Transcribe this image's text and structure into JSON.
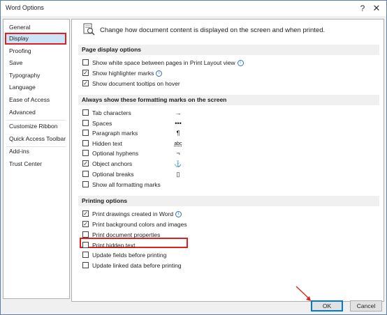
{
  "window": {
    "title": "Word Options",
    "help_icon": "?",
    "close_icon": "✕"
  },
  "sidebar": {
    "items": [
      {
        "label": "General"
      },
      {
        "label": "Display",
        "selected": true
      },
      {
        "label": "Proofing"
      },
      {
        "label": "Save"
      },
      {
        "label": "Typography"
      },
      {
        "label": "Language"
      },
      {
        "label": "Ease of Access"
      },
      {
        "label": "Advanced"
      },
      {
        "label": "Customize Ribbon"
      },
      {
        "label": "Quick Access Toolbar"
      },
      {
        "label": "Add-ins"
      },
      {
        "label": "Trust Center"
      }
    ]
  },
  "header": {
    "text": "Change how document content is displayed on the screen and when printed."
  },
  "sections": {
    "page_display": {
      "title": "Page display options",
      "options": [
        {
          "label": "Show white space between pages in Print Layout view",
          "checked": false,
          "info": true
        },
        {
          "label": "Show highlighter marks",
          "checked": true,
          "info": true
        },
        {
          "label": "Show document tooltips on hover",
          "checked": true
        }
      ]
    },
    "formatting_marks": {
      "title": "Always show these formatting marks on the screen",
      "options": [
        {
          "label": "Tab characters",
          "checked": false,
          "symbol": "→"
        },
        {
          "label": "Spaces",
          "checked": false,
          "symbol": "•••"
        },
        {
          "label": "Paragraph marks",
          "checked": false,
          "symbol": "¶"
        },
        {
          "label": "Hidden text",
          "checked": false,
          "symbol": "abc"
        },
        {
          "label": "Optional hyphens",
          "checked": false,
          "symbol": "¬"
        },
        {
          "label": "Object anchors",
          "checked": true,
          "symbol": "⚓"
        },
        {
          "label": "Optional breaks",
          "checked": false,
          "symbol": "▯"
        },
        {
          "label": "Show all formatting marks",
          "checked": false
        }
      ]
    },
    "printing": {
      "title": "Printing options",
      "options": [
        {
          "label": "Print drawings created in Word",
          "checked": true,
          "info": true
        },
        {
          "label": "Print background colors and images",
          "checked": true
        },
        {
          "label": "Print document properties",
          "checked": false
        },
        {
          "label": "Print hidden text",
          "checked": false
        },
        {
          "label": "Update fields before printing",
          "checked": false
        },
        {
          "label": "Update linked data before printing",
          "checked": false
        }
      ]
    }
  },
  "footer": {
    "ok_label": "OK",
    "cancel_label": "Cancel"
  },
  "colors": {
    "highlight_red": "#e02020",
    "selected_bg": "#cce4f7",
    "accent_blue": "#0078d7"
  }
}
